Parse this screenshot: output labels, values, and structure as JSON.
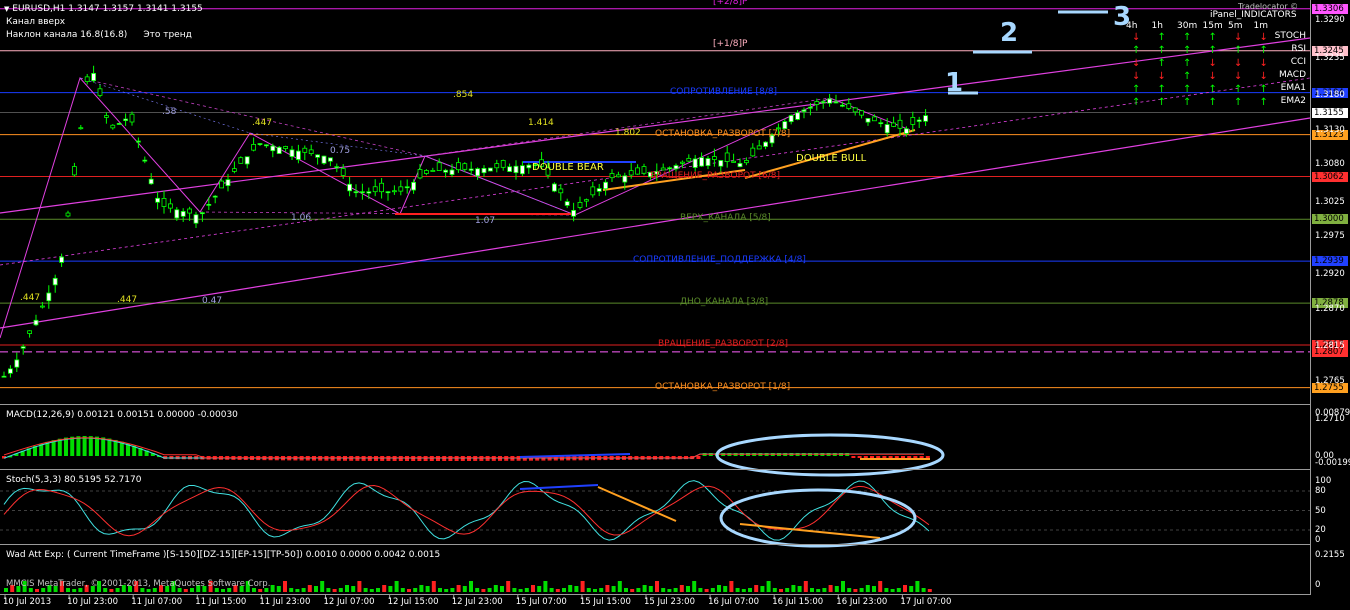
{
  "header": {
    "symbol_line": "EURUSD,H1  1.3147 1.3157 1.3141 1.3155",
    "channel": "Канал  вверх",
    "slope": "Наклон канала 16.8(16.8)",
    "trend": "Это тренд"
  },
  "murrey_levels": [
    {
      "label": "[+2/8]P",
      "price": 1.3306,
      "color": "#e020e0",
      "tag": "1.3306",
      "tag_bg": "#ff55ff"
    },
    {
      "label": "[+1/8]P",
      "price": 1.3245,
      "color": "#ffb0c0",
      "tag": "1.3245",
      "tag_bg": "#ffc0cb"
    },
    {
      "label": "СОПРОТИВЛЕНИЕ  [8/8]",
      "price": 1.3184,
      "color": "#1a3cff",
      "tag": "1.3184",
      "tag_bg": "#2040ff"
    },
    {
      "label": "ОСТАНОВКА_РАЗВОРОТ  [7/8]",
      "price": 1.3123,
      "color": "#ff9020",
      "tag": "1.3123",
      "tag_bg": "#ffa020"
    },
    {
      "label": "ВРАЩЕНИЕ_РАЗВОРОТ  [6/8]",
      "price": 1.3062,
      "color": "#e02020",
      "tag": "1.3062",
      "tag_bg": "#ff3030"
    },
    {
      "label": "ВЕРХ_КАНАЛА  [5/8]",
      "price": 1.3,
      "color": "#5a8a2a",
      "tag": "1.3000",
      "tag_bg": "#80b040"
    },
    {
      "label": "СОПРОТИВЛЕНИЕ_ПОДДЕРЖКА  [4/8]",
      "price": 1.2939,
      "color": "#1a3cff",
      "tag": "1.2939",
      "tag_bg": "#2040ff"
    },
    {
      "label": "ДНО_КАНАЛА  [3/8]",
      "price": 1.2878,
      "color": "#5a8a2a",
      "tag": "1.2878",
      "tag_bg": "#80b040"
    },
    {
      "label": "ВРАЩЕНИЕ_РАЗВОРОТ  [2/8]",
      "price": 1.2817,
      "color": "#e02020",
      "tag": "1.2817",
      "tag_bg": "#ff3030"
    },
    {
      "label": "ОСТАНОВКА_РАЗВОРОТ  [1/8]",
      "price": 1.2755,
      "color": "#ff9020",
      "tag": "1.2755",
      "tag_bg": "#ffa020"
    }
  ],
  "extra_tags": [
    {
      "text": "1.3155",
      "price": 1.3155,
      "bg": "#ffffff"
    },
    {
      "text": "1.2807",
      "price": 1.2807,
      "bg": "#ff3030"
    }
  ],
  "price_axis": {
    "min": 1.274,
    "max": 1.331,
    "labels": [
      "1.3290",
      "1.3235",
      "1.3180",
      "1.3130",
      "1.3080",
      "1.3025",
      "1.2975",
      "1.2920",
      "1.2870",
      "1.2815",
      "1.2765",
      "1.2710"
    ]
  },
  "annotations": {
    "fib_labels": [
      ".854",
      "1.414",
      "1.802",
      ".447",
      ".58",
      "0.75",
      "1.06",
      "1.07",
      ".447",
      ".447",
      "0.47"
    ],
    "double_bear": "DOUBLE  BEAR",
    "double_bull": "DOUBLE  BULL",
    "hand_numbers": [
      "1",
      "2",
      "3"
    ],
    "watermark": "MMCIS MetaTrader, © 2001-2013, MetaQuotes Software Corp."
  },
  "ipanel": {
    "title": "iPanel_INDICATORS",
    "overlay": "Tradelocator ©",
    "timeframes": [
      "4h",
      "1h",
      "30m",
      "15m",
      "5m",
      "1m"
    ],
    "rows": [
      {
        "name": "STOCH",
        "signals": [
          "down",
          "up",
          "up",
          "up",
          "down",
          "down"
        ]
      },
      {
        "name": "RSI",
        "signals": [
          "up",
          "up",
          "up",
          "up",
          "up",
          "up"
        ]
      },
      {
        "name": "CCI",
        "signals": [
          "down",
          "up",
          "up",
          "down",
          "down",
          "down"
        ]
      },
      {
        "name": "MACD",
        "signals": [
          "down",
          "down",
          "up",
          "down",
          "down",
          "down"
        ]
      },
      {
        "name": "EMA1",
        "signals": [
          "up",
          "up",
          "up",
          "up",
          "up",
          "up"
        ]
      },
      {
        "name": "EMA2",
        "signals": [
          "up",
          "up",
          "up",
          "up",
          "up",
          "up"
        ]
      }
    ]
  },
  "macd": {
    "title": "MACD(12,26,9) 0.00121 0.00151 0.00000 -0.00030",
    "axis": [
      "0.00879",
      "0.00",
      "-0.00199"
    ]
  },
  "stoch": {
    "title": "Stoch(5,3,3) 80.5195 52.7170",
    "axis": [
      "100",
      "80",
      "50",
      "20",
      "0"
    ]
  },
  "wad": {
    "title": "Wad Att Exp: ( Current TimeFrame )[S-150][DZ-15][EP-15][TP-50]) 0.0010 0.0000 0.0042 0.0015",
    "axis": [
      "0.2155",
      "0"
    ]
  },
  "time_axis": [
    "10 Jul 2013",
    "10 Jul 23:00",
    "11 Jul 07:00",
    "11 Jul 15:00",
    "11 Jul 23:00",
    "12 Jul 07:00",
    "12 Jul 15:00",
    "12 Jul 23:00",
    "15 Jul 07:00",
    "15 Jul 15:00",
    "15 Jul 23:00",
    "16 Jul 07:00",
    "16 Jul 15:00",
    "16 Jul 23:00",
    "17 Jul 07:00"
  ],
  "colors": {
    "bull": "#ffffff",
    "bear": "#ffffff",
    "wick": "#00ff00",
    "stoch_k": "#40e0e0",
    "stoch_d": "#ff3030",
    "hist_up": "#00dd00",
    "hist_down": "#ff2020",
    "circle": "#a8d8ff"
  }
}
